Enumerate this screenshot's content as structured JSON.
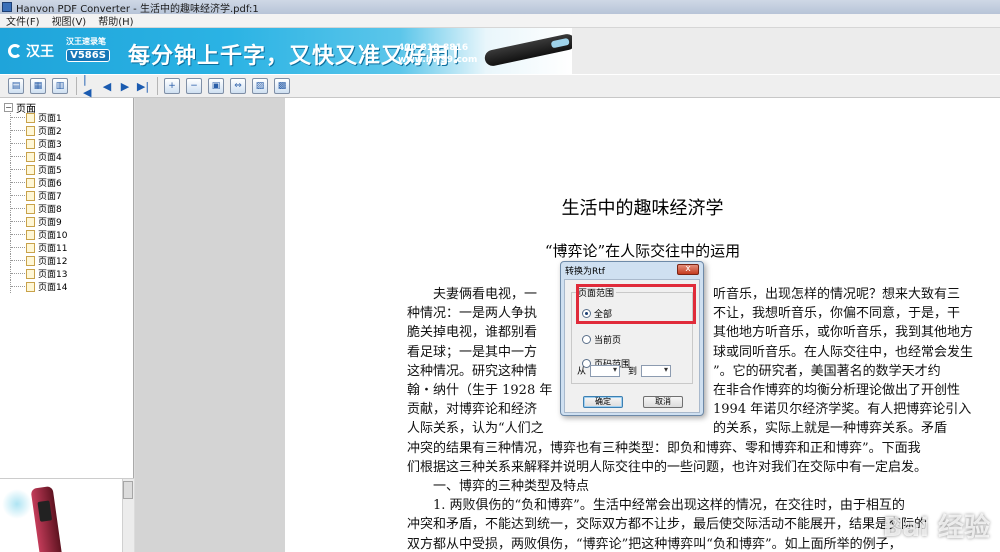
{
  "window": {
    "title": "Hanvon PDF Converter - 生活中的趣味经济学.pdf:1"
  },
  "menu": [
    "文件(F)",
    "视图(V)",
    "帮助(H)"
  ],
  "banner": {
    "brand": "汉王",
    "product_name": "汉王速录笔",
    "product_model": "V586S",
    "slogan": "每分钟上千字，又快又准又好用！",
    "hotline": "400-810-8816",
    "website": "www.hw99.com"
  },
  "toolbar": {
    "buttons": [
      {
        "name": "open-icon",
        "glyph": "▤"
      },
      {
        "name": "convert-icon",
        "glyph": "▦"
      },
      {
        "name": "export-icon",
        "glyph": "▥"
      }
    ],
    "nav": [
      {
        "name": "first-page-icon",
        "glyph": "|◀"
      },
      {
        "name": "prev-page-icon",
        "glyph": "◀"
      },
      {
        "name": "next-page-icon",
        "glyph": "▶"
      },
      {
        "name": "last-page-icon",
        "glyph": "▶|"
      }
    ],
    "view_buttons": [
      {
        "name": "zoom-in-icon",
        "glyph": "+"
      },
      {
        "name": "zoom-out-icon",
        "glyph": "−"
      },
      {
        "name": "fit-page-icon",
        "glyph": "▣"
      },
      {
        "name": "fit-width-icon",
        "glyph": "⇔"
      },
      {
        "name": "image-icon",
        "glyph": "▨"
      },
      {
        "name": "settings-icon",
        "glyph": "▩"
      }
    ]
  },
  "sidebar": {
    "root_toggle": "−",
    "root_label": "页面",
    "pages": [
      "页面1",
      "页面2",
      "页面3",
      "页面4",
      "页面5",
      "页面6",
      "页面7",
      "页面8",
      "页面9",
      "页面10",
      "页面11",
      "页面12",
      "页面13",
      "页面14"
    ]
  },
  "document": {
    "title": "生活中的趣味经济学",
    "subtitle": "“博弈论”在人际交往中的运用",
    "paragraphs": [
      {
        "indent": true,
        "text": "夫妻俩看电视，一"
      },
      {
        "indent": false,
        "text": "种情况：一是两人争执"
      },
      {
        "indent": false,
        "text": "脆关掉电视，谁都别看"
      },
      {
        "indent": false,
        "text": "看足球；一是其中一方"
      },
      {
        "indent": false,
        "text": "这种情况。研究这种情"
      },
      {
        "indent": false,
        "text": "翰・纳什（生于 1928 年"
      },
      {
        "indent": false,
        "text": "贡献，对博弈论和经济"
      },
      {
        "indent": false,
        "text": "人际关系，认为“人们之"
      },
      {
        "indent": false,
        "text": "冲突的结果有三种情况，博弈也有三种类型：即负和博弈、零和博弈和正和博弈”。下面我"
      },
      {
        "indent": false,
        "text": "们根据这三种关系来解释并说明人际交往中的一些问题，也许对我们在交际中有一定启发。"
      },
      {
        "indent": true,
        "text": "一、博弈的三种类型及特点"
      },
      {
        "indent": true,
        "text": "1. 两败俱伤的“负和博弈”。生活中经常会出现这样的情况，在交往时，由于相互的"
      },
      {
        "indent": false,
        "text": "冲突和矛盾，不能达到统一，交际双方都不让步，最后使交际活动不能展开，结果是交际的"
      },
      {
        "indent": false,
        "text": "双方都从中受损，两败俱伤，“博弈论”把这种博弈叫“负和博弈”。如上面所举的例子，"
      }
    ],
    "right_fragments": [
      "听音乐，出现怎样的情况呢？想来大致有三",
      "不让，我想听音乐，你偏不同意，于是，干",
      "其他地方听音乐，或你听音乐，我到其他地方",
      "球或同听音乐。在人际交往中，也经常会发生",
      "”。它的研究者，美国著名的数学天才约",
      "在非合作博弈的均衡分析理论做出了开创性",
      "1994 年诺贝尔经济学奖。有人把博弈论引入",
      "的关系，实际上就是一种博弈关系。矛盾"
    ],
    "watermark": "Bai 经验"
  },
  "dialog": {
    "title": "转换为Rtf",
    "close_glyph": "x",
    "group_label": "页面范围",
    "options": [
      {
        "label": "全部",
        "checked": true
      },
      {
        "label": "当前页",
        "checked": false
      },
      {
        "label": "页码范围",
        "checked": false
      }
    ],
    "from_label": "从",
    "to_label": "到",
    "from_value": "",
    "to_value": "",
    "ok_label": "确定",
    "cancel_label": "取消"
  },
  "colors": {
    "highlight": "#e02b3a",
    "banner_blue": "#1fa4da",
    "dialog_frame": "#cfe0f1"
  }
}
